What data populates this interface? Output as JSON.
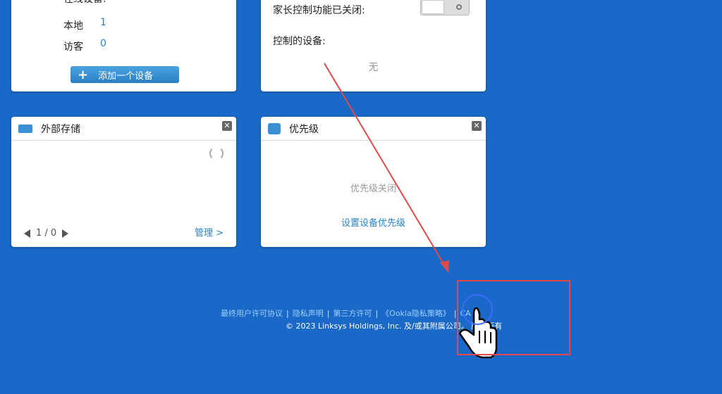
{
  "devices_card": {
    "online_label": "在线设备:",
    "local_label": "本地",
    "local_count": "1",
    "guest_label": "访客",
    "guest_count": "0",
    "add_button": "添加一个设备"
  },
  "parental_card": {
    "status_label": "家长控制功能已关闭:",
    "controlled_label": "控制的设备:",
    "none_text": "无"
  },
  "storage_card": {
    "title": "外部存储",
    "pager_text": "1 / 0",
    "manage_link": "管理 >"
  },
  "priority_card": {
    "title": "优先级",
    "status_text": "优先级关闭",
    "set_link": "设置设备优先级"
  },
  "footer": {
    "links": [
      "最终用户许可协议",
      "隐私声明",
      "第三方许可",
      "《Ookla隐私策略》",
      "CA"
    ],
    "copyright": "© 2023 Linksys Holdings, Inc. 及/或其附属公司。 版权所有"
  },
  "colors": {
    "background": "#1a68c8",
    "link": "#2a83c8",
    "annotation_red": "#e04a4a"
  }
}
